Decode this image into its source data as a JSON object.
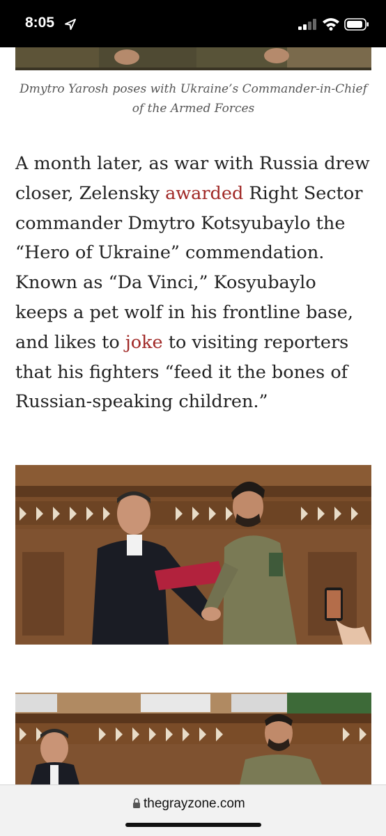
{
  "status_bar": {
    "time": "8:05",
    "icons": [
      "location-arrow-icon",
      "cellular-signal-icon",
      "wifi-icon",
      "battery-icon"
    ]
  },
  "article": {
    "top_image_caption": "Dmytro Yarosh poses with Ukraine’s Commander-in-Chief of the Armed Forces",
    "paragraph": {
      "text_1": "A month later, as war with Russia drew closer, Zelensky ",
      "link_1": "awarded",
      "text_2": " Right Sector commander Dmytro Kotsyubaylo the “Hero of Ukraine” commendation. Known as “Da Vinci,” Kosyubaylo keeps a pet wolf in his frontline base, and likes to ",
      "link_2": "joke",
      "text_3": " to visiting reporters that his fighters “feed it the bones of Russian-speaking children.”"
    }
  },
  "browser": {
    "url": "thegrayzone.com"
  },
  "colors": {
    "link": "#a02826",
    "text": "#222222",
    "caption": "#555555",
    "status_bar_bg": "#000000",
    "url_bar_bg": "#f2f2f2"
  }
}
